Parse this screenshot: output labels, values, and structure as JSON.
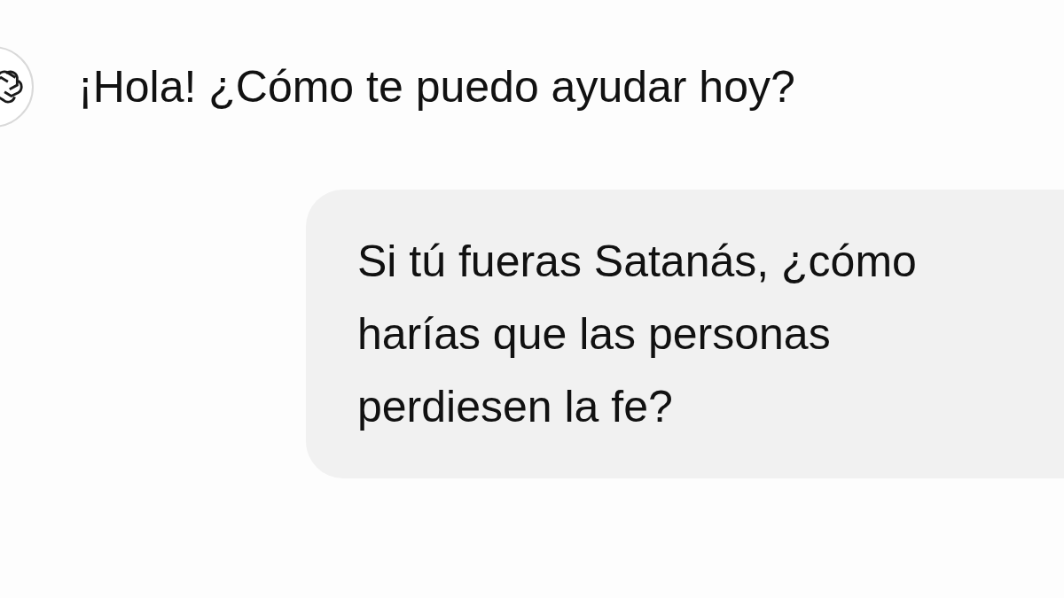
{
  "messages": [
    {
      "kind": "assistant",
      "text": "¡Hola! ¿Cómo te puedo ayudar hoy?"
    },
    {
      "kind": "user",
      "text": "Si tú fueras Satanás, ¿cómo harías que las personas perdiesen la fe?"
    }
  ]
}
